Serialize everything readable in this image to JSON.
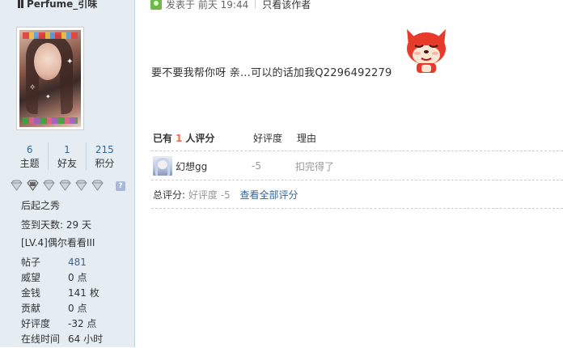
{
  "profile": {
    "username": "Perfume_引味",
    "stats": [
      {
        "num": "6",
        "label": "主题"
      },
      {
        "num": "1",
        "label": "好友"
      },
      {
        "num": "215",
        "label": "积分"
      }
    ],
    "medal_count": 6,
    "titles": [
      "后起之秀",
      "签到天数: 29 天",
      "[LV.4]偶尔看看III"
    ],
    "info": [
      {
        "k": "帖子",
        "v": "481"
      },
      {
        "k": "威望",
        "v": "0 点"
      },
      {
        "k": "金钱",
        "v": "141 枚"
      },
      {
        "k": "贡献",
        "v": "0 点"
      },
      {
        "k": "好评度",
        "v": "-32 点"
      },
      {
        "k": "在线时间",
        "v": "64 小时"
      }
    ]
  },
  "post": {
    "time": "发表于 前天 19:44",
    "only_author": "只看该作者",
    "body": "要不要我帮你呀 亲…可以的话加我Q2296492279"
  },
  "rating": {
    "prefix": "已有",
    "count": "1",
    "suffix": "人评分",
    "col_score": "好评度",
    "col_reason": "理由",
    "rows": [
      {
        "user": "幻想gg",
        "score": "-5",
        "reason": "扣完得了"
      }
    ],
    "total_label": "总评分:",
    "total_value": "好评度 -5",
    "view_all": "查看全部评分"
  },
  "colors": {
    "link": "#336699",
    "accent": "#f26c4f",
    "sidebar": "#e5edf2"
  }
}
